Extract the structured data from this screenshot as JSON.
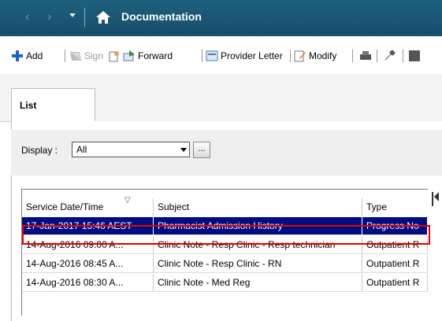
{
  "header": {
    "back_icon": "‹",
    "forward_icon": "›",
    "title": "Documentation"
  },
  "toolbar": {
    "add_label": "Add",
    "sign_label": "Sign",
    "forward_label": "Forward",
    "provider_letter_label": "Provider Letter",
    "modify_label": "Modify"
  },
  "tabs": [
    {
      "label": "List"
    }
  ],
  "display": {
    "label": "Display :",
    "selected": "All",
    "ellipsis_label": "..."
  },
  "table": {
    "columns": [
      "Service Date/Time",
      "Subject",
      "Type"
    ],
    "sort_indicator": "▽",
    "rows": [
      {
        "date": "17-Jan-2017 15:46 AEST",
        "subject": "Pharmacist Admission History",
        "type": "Progress No",
        "selected": true
      },
      {
        "date": "14-Aug-2016 09:00 A...",
        "subject": "Clinic Note - Resp Clinic - Resp technician",
        "type": "Outpatient R",
        "selected": false
      },
      {
        "date": "14-Aug-2016 08:45 A...",
        "subject": "Clinic Note - Resp Clinic - RN",
        "type": "Outpatient R",
        "selected": false
      },
      {
        "date": "14-Aug-2016 08:30 A...",
        "subject": "Clinic Note - Med Reg",
        "type": "Outpatient R",
        "selected": false
      }
    ]
  },
  "colors": {
    "titlebar": "#1a5673",
    "selection": "#000d80",
    "highlight_outline": "#e30000"
  }
}
